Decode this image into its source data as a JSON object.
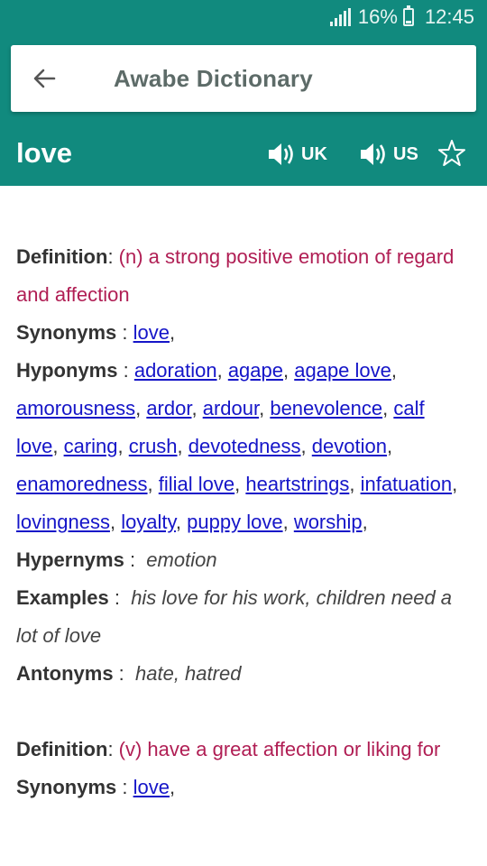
{
  "status_bar": {
    "battery_percent": "16%",
    "time": "12:45"
  },
  "header": {
    "back_icon": "arrow-left-icon",
    "title": "Awabe Dictionary"
  },
  "word_bar": {
    "word": "love",
    "uk_label": "UK",
    "us_label": "US",
    "speaker_icon": "speaker-icon",
    "favorite_icon": "star-outline-icon"
  },
  "labels": {
    "definition": "Definition",
    "synonyms": "Synonyms",
    "hyponyms": "Hyponyms",
    "hypernyms": "Hypernyms",
    "examples": "Examples",
    "antonyms": "Antonyms"
  },
  "entries": [
    {
      "definition": "(n) a strong positive emotion of regard and affection",
      "synonyms": [
        "love"
      ],
      "hyponyms": [
        "adoration",
        "agape",
        "agape love",
        "amorousness",
        "ardor",
        "ardour",
        "benevolence",
        "calf love",
        "caring",
        "crush",
        "devotedness",
        "devotion",
        "enamoredness",
        "filial love",
        "heartstrings",
        "infatuation",
        "lovingness",
        "loyalty",
        "puppy love",
        "worship"
      ],
      "hypernyms": "emotion",
      "examples": "his love for his work, children need a lot of love",
      "antonyms": "hate, hatred"
    },
    {
      "definition": "(v) have a great affection or liking for",
      "synonyms": [
        "love"
      ]
    }
  ],
  "colors": {
    "teal": "#118a7e",
    "definition": "#b01e54",
    "link": "#1515c8"
  }
}
